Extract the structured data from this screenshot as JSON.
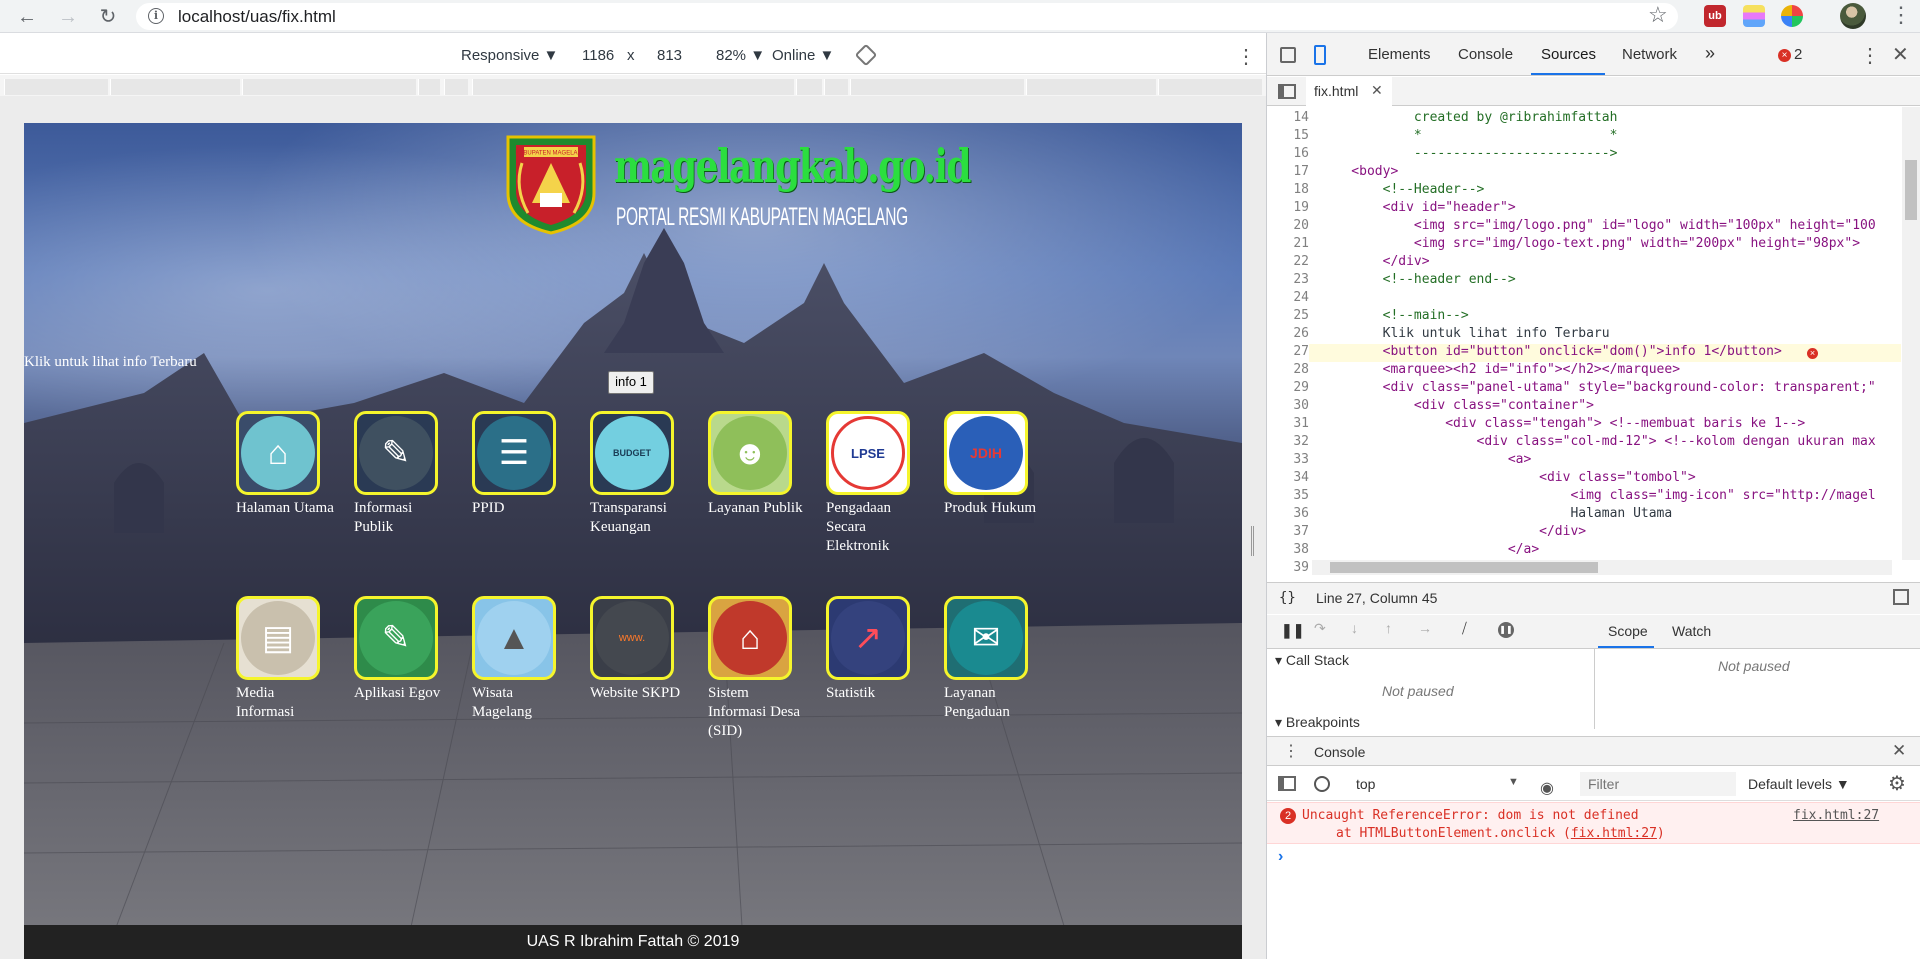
{
  "browser": {
    "url": "localhost/uas/fix.html",
    "back_icon": "arrow-left-icon",
    "forward_icon": "arrow-right-icon",
    "reload_icon": "reload-icon"
  },
  "device_toolbar": {
    "mode": "Responsive ▼",
    "width": "1186",
    "times": "x",
    "height": "813",
    "zoom": "82% ▼",
    "network": "Online ▼"
  },
  "page": {
    "logo_title": "magelangkab.go.id",
    "logo_subtitle": "PORTAL RESMI KABUPATEN MAGELANG",
    "logo_badge": "KABUPATEN MAGELANG",
    "intro_text": "Klik untuk lihat info Terbaru",
    "info_button": "info 1",
    "row1": [
      {
        "label": "Halaman Utama"
      },
      {
        "label": "Informasi Publik"
      },
      {
        "label": "PPID"
      },
      {
        "label": "Transparansi Keuangan"
      },
      {
        "label": "Layanan Publik"
      },
      {
        "label": "Pengadaan Secara Elektronik"
      },
      {
        "label": "Produk Hukum"
      }
    ],
    "row2": [
      {
        "label": "Media Informasi"
      },
      {
        "label": "Aplikasi Egov"
      },
      {
        "label": "Wisata Magelang"
      },
      {
        "label": "Website SKPD"
      },
      {
        "label": "Sistem Informasi Desa (SID)"
      },
      {
        "label": "Statistik"
      },
      {
        "label": "Layanan Pengaduan"
      }
    ],
    "icon_texts": {
      "budget": "BUDGET",
      "lpse": "LPSE",
      "www": "www.",
      "jdih": "JDIH"
    },
    "footer": "UAS R Ibrahim Fattah © 2019"
  },
  "devtools": {
    "tabs": [
      "Elements",
      "Console",
      "Sources",
      "Network"
    ],
    "more": "»",
    "error_count": "2",
    "file_tab": "fix.html",
    "code_lines": [
      {
        "n": "14",
        "t": "            created by @ribrahimfattah"
      },
      {
        "n": "15",
        "t": "            *                        *"
      },
      {
        "n": "16",
        "t": "            ------------------------->"
      },
      {
        "n": "17",
        "t": "    <body>"
      },
      {
        "n": "18",
        "t": "        <!--Header-->"
      },
      {
        "n": "19",
        "t": "        <div id=\"header\">"
      },
      {
        "n": "20",
        "t": "            <img src=\"img/logo.png\" id=\"logo\" width=\"100px\" height=\"100"
      },
      {
        "n": "21",
        "t": "            <img src=\"img/logo-text.png\" width=\"200px\" height=\"98px\">"
      },
      {
        "n": "22",
        "t": "        </div>"
      },
      {
        "n": "23",
        "t": "        <!--header end-->"
      },
      {
        "n": "24",
        "t": ""
      },
      {
        "n": "25",
        "t": "        <!--main-->"
      },
      {
        "n": "26",
        "t": "        Klik untuk lihat info Terbaru"
      },
      {
        "n": "27",
        "t": "        <button id=\"button\" onclick=\"dom()\">info 1</button>"
      },
      {
        "n": "28",
        "t": "        <marquee><h2 id=\"info\"></h2></marquee>"
      },
      {
        "n": "29",
        "t": "        <div class=\"panel-utama\" style=\"background-color: transparent;\""
      },
      {
        "n": "30",
        "t": "            <div class=\"container\">"
      },
      {
        "n": "31",
        "t": "                <div class=\"tengah\"> <!--membuat baris ke 1-->"
      },
      {
        "n": "32",
        "t": "                    <div class=\"col-md-12\"> <!--kolom dengan ukuran max"
      },
      {
        "n": "33",
        "t": "                        <a>"
      },
      {
        "n": "34",
        "t": "                            <div class=\"tombol\">"
      },
      {
        "n": "35",
        "t": "                                <img class=\"img-icon\" src=\"http://magel"
      },
      {
        "n": "36",
        "t": "                                Halaman Utama"
      },
      {
        "n": "37",
        "t": "                            </div>"
      },
      {
        "n": "38",
        "t": "                        </a>"
      },
      {
        "n": "39",
        "t": "                    </div>"
      }
    ],
    "status_line": "Line 27, Column 45",
    "scope_tab": "Scope",
    "watch_tab": "Watch",
    "call_stack": "Call Stack",
    "not_paused": "Not paused",
    "breakpoints": "Breakpoints",
    "console_title": "Console",
    "context": "top",
    "filter_placeholder": "Filter",
    "levels": "Default levels ▼",
    "error_badge": "2",
    "error_msg": "Uncaught ReferenceError: dom is not defined",
    "error_stack_prefix": "at HTMLButtonElement.onclick (",
    "error_stack_link": "fix.html:27",
    "error_stack_suffix": ")",
    "error_link": "fix.html:27",
    "prompt": "›"
  }
}
